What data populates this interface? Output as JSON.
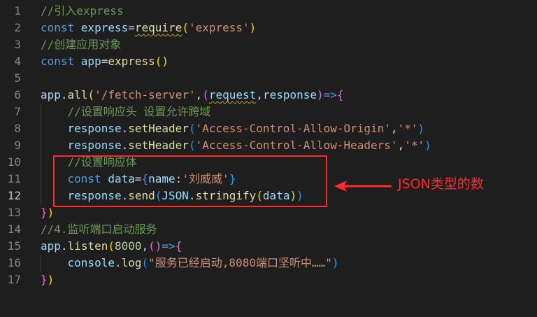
{
  "editor": {
    "active_line": 12,
    "lines": [
      {
        "num": "1",
        "tokens": [
          {
            "t": "//引入express",
            "c": "com"
          }
        ]
      },
      {
        "num": "2",
        "tokens": [
          {
            "t": "const ",
            "c": "kw"
          },
          {
            "t": "express",
            "c": "var"
          },
          {
            "t": "=",
            "c": "op"
          },
          {
            "t": "require",
            "c": "fn",
            "sq": true
          },
          {
            "t": "(",
            "c": "br1"
          },
          {
            "t": "'express'",
            "c": "str"
          },
          {
            "t": ")",
            "c": "br1"
          }
        ]
      },
      {
        "num": "3",
        "tokens": [
          {
            "t": "//创建应用对象",
            "c": "com"
          }
        ]
      },
      {
        "num": "4",
        "tokens": [
          {
            "t": "const ",
            "c": "kw"
          },
          {
            "t": "app",
            "c": "var"
          },
          {
            "t": "=",
            "c": "op"
          },
          {
            "t": "express",
            "c": "fn"
          },
          {
            "t": "()",
            "c": "br1"
          }
        ]
      },
      {
        "num": "5",
        "tokens": []
      },
      {
        "num": "6",
        "tokens": [
          {
            "t": "app",
            "c": "var"
          },
          {
            "t": ".",
            "c": "op"
          },
          {
            "t": "all",
            "c": "fn"
          },
          {
            "t": "(",
            "c": "br1"
          },
          {
            "t": "'/fetch-server'",
            "c": "str"
          },
          {
            "t": ",",
            "c": "op"
          },
          {
            "t": "(",
            "c": "br2"
          },
          {
            "t": "request",
            "c": "var",
            "sq": true
          },
          {
            "t": ",",
            "c": "op"
          },
          {
            "t": "response",
            "c": "var"
          },
          {
            "t": ")",
            "c": "br2"
          },
          {
            "t": "=>",
            "c": "kw"
          },
          {
            "t": "{",
            "c": "br2"
          }
        ]
      },
      {
        "num": "7",
        "indent": true,
        "tokens": [
          {
            "t": "    ",
            "c": "op"
          },
          {
            "t": "//设置响应头 设置允许跨域",
            "c": "com"
          }
        ]
      },
      {
        "num": "8",
        "indent": true,
        "tokens": [
          {
            "t": "    ",
            "c": "op"
          },
          {
            "t": "response",
            "c": "var"
          },
          {
            "t": ".",
            "c": "op"
          },
          {
            "t": "setHeader",
            "c": "fn"
          },
          {
            "t": "(",
            "c": "br3"
          },
          {
            "t": "'Access-Control-Allow-Origin'",
            "c": "str"
          },
          {
            "t": ",",
            "c": "op"
          },
          {
            "t": "'*'",
            "c": "str"
          },
          {
            "t": ")",
            "c": "br3"
          }
        ]
      },
      {
        "num": "9",
        "indent": true,
        "tokens": [
          {
            "t": "    ",
            "c": "op"
          },
          {
            "t": "response",
            "c": "var"
          },
          {
            "t": ".",
            "c": "op"
          },
          {
            "t": "setHeader",
            "c": "fn"
          },
          {
            "t": "(",
            "c": "br3"
          },
          {
            "t": "'Access-Control-Allow-Headers'",
            "c": "str"
          },
          {
            "t": ",",
            "c": "op"
          },
          {
            "t": "'*'",
            "c": "str"
          },
          {
            "t": ")",
            "c": "br3"
          }
        ]
      },
      {
        "num": "10",
        "indent": true,
        "tokens": [
          {
            "t": "    ",
            "c": "op"
          },
          {
            "t": "//设置响应体",
            "c": "com"
          }
        ]
      },
      {
        "num": "11",
        "indent": true,
        "tokens": [
          {
            "t": "    ",
            "c": "op"
          },
          {
            "t": "const ",
            "c": "kw"
          },
          {
            "t": "data",
            "c": "var"
          },
          {
            "t": "=",
            "c": "op"
          },
          {
            "t": "{",
            "c": "br3"
          },
          {
            "t": "name",
            "c": "var"
          },
          {
            "t": ":",
            "c": "op"
          },
          {
            "t": "'刘威威'",
            "c": "str"
          },
          {
            "t": "}",
            "c": "br3"
          }
        ]
      },
      {
        "num": "12",
        "indent": true,
        "tokens": [
          {
            "t": "    ",
            "c": "op"
          },
          {
            "t": "response",
            "c": "var"
          },
          {
            "t": ".",
            "c": "op"
          },
          {
            "t": "send",
            "c": "fn"
          },
          {
            "t": "(",
            "c": "br3"
          },
          {
            "t": "JSON",
            "c": "var"
          },
          {
            "t": ".",
            "c": "op"
          },
          {
            "t": "stringify",
            "c": "fn"
          },
          {
            "t": "(",
            "c": "br1"
          },
          {
            "t": "data",
            "c": "var"
          },
          {
            "t": ")",
            "c": "br1"
          },
          {
            "t": ")",
            "c": "br3"
          }
        ]
      },
      {
        "num": "13",
        "tokens": [
          {
            "t": "}",
            "c": "br2"
          },
          {
            "t": ")",
            "c": "br1"
          }
        ]
      },
      {
        "num": "14",
        "tokens": [
          {
            "t": "//4.监听端口启动服务",
            "c": "com"
          }
        ]
      },
      {
        "num": "15",
        "tokens": [
          {
            "t": "app",
            "c": "var"
          },
          {
            "t": ".",
            "c": "op"
          },
          {
            "t": "listen",
            "c": "fn"
          },
          {
            "t": "(",
            "c": "br1"
          },
          {
            "t": "8000",
            "c": "num"
          },
          {
            "t": ",",
            "c": "op"
          },
          {
            "t": "()",
            "c": "br2"
          },
          {
            "t": "=>",
            "c": "kw"
          },
          {
            "t": "{",
            "c": "br2"
          }
        ]
      },
      {
        "num": "16",
        "indent": true,
        "tokens": [
          {
            "t": "    ",
            "c": "op"
          },
          {
            "t": "console",
            "c": "var"
          },
          {
            "t": ".",
            "c": "op"
          },
          {
            "t": "log",
            "c": "fn"
          },
          {
            "t": "(",
            "c": "br3"
          },
          {
            "t": "\"服务已经启动,8080端口坚听中……\"",
            "c": "str"
          },
          {
            "t": ")",
            "c": "br3"
          }
        ]
      },
      {
        "num": "17",
        "tokens": [
          {
            "t": "}",
            "c": "br2"
          },
          {
            "t": ")",
            "c": "br1"
          }
        ]
      }
    ]
  },
  "annotation": {
    "label": "JSON类型的数",
    "color": "#ff2b2b"
  }
}
